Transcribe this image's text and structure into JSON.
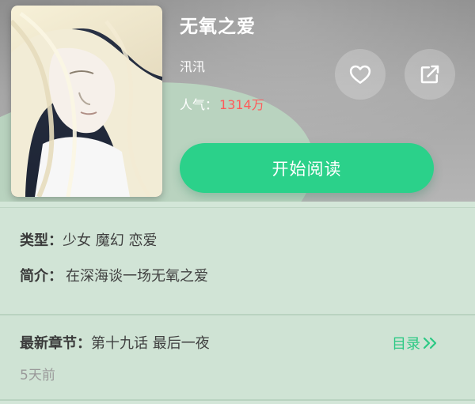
{
  "header": {
    "title": "无氧之爱",
    "author": "汛汛",
    "popularity_label": "人气：",
    "popularity_value": "1314万"
  },
  "actions": {
    "read_label": "开始阅读"
  },
  "details": {
    "genre_label": "类型",
    "genre_value": "少女 魔幻 恋爱",
    "intro_label": "简介",
    "intro_value": "在深海谈一场无氧之爱"
  },
  "latest": {
    "label": "最新章节",
    "chapter": "第十九话 最后一夜",
    "updated": "5天前",
    "catalog_label": "目录"
  },
  "icons": {
    "favorite": "heart-icon",
    "share": "share-icon",
    "catalog_arrow": "double-chevron-right-icon"
  },
  "colors": {
    "accent": "#2bd18a",
    "popularity": "#ff5a5a",
    "catalog": "#2bc984"
  }
}
